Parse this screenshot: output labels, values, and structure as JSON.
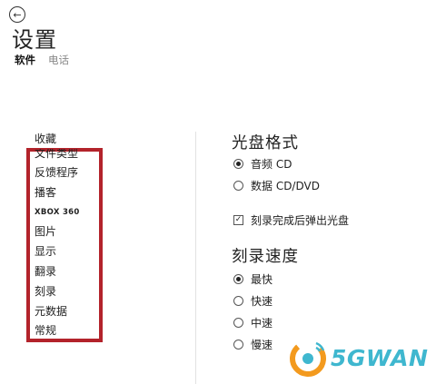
{
  "header": {
    "back_icon": "back-arrow-icon",
    "title": "设置",
    "tabs": [
      {
        "label": "软件",
        "active": true
      },
      {
        "label": "电话",
        "active": false
      }
    ]
  },
  "sidebar": {
    "heading": "收藏",
    "highlight_color": "#b3232b",
    "items": [
      {
        "label": "文件类型"
      },
      {
        "label": "反馈程序"
      },
      {
        "label": "播客"
      },
      {
        "label": "XBOX 360"
      },
      {
        "label": "图片"
      },
      {
        "label": "显示"
      },
      {
        "label": "翻录"
      },
      {
        "label": "刻录"
      },
      {
        "label": "元数据"
      },
      {
        "label": "常规"
      }
    ]
  },
  "main": {
    "disc_format": {
      "title": "光盘格式",
      "options": [
        {
          "label": "音频 CD",
          "checked": true
        },
        {
          "label": "数据 CD/DVD",
          "checked": false
        }
      ]
    },
    "eject_checkbox": {
      "label": "刻录完成后弹出光盘",
      "checked": true,
      "mark": "✓"
    },
    "burn_speed": {
      "title": "刻录速度",
      "options": [
        {
          "label": "最快",
          "checked": true
        },
        {
          "label": "快速",
          "checked": false
        },
        {
          "label": "中速",
          "checked": false
        },
        {
          "label": "慢速",
          "checked": false
        }
      ]
    }
  },
  "watermark": {
    "text": "5GWAN",
    "color": "#3fb7cf",
    "accent": "#f39a1e"
  }
}
